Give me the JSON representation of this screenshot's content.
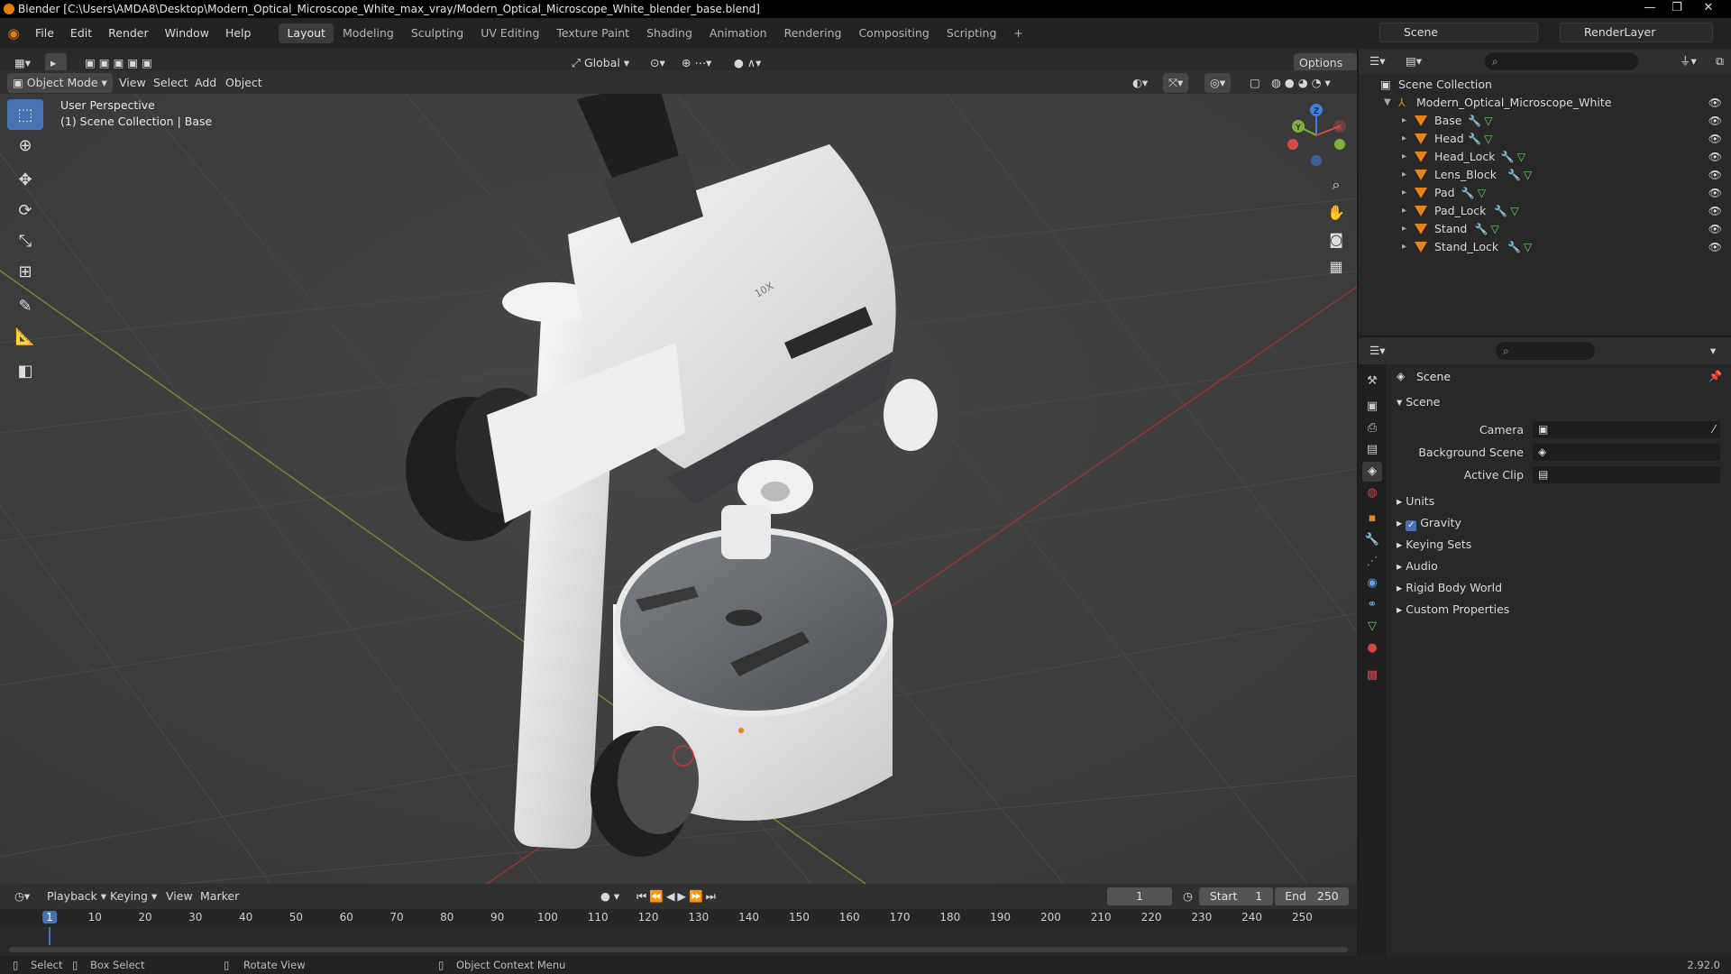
{
  "window": {
    "title": "Blender [C:\\Users\\AMDA8\\Desktop\\Modern_Optical_Microscope_White_max_vray/Modern_Optical_Microscope_White_blender_base.blend]"
  },
  "menu": {
    "items": [
      "File",
      "Edit",
      "Render",
      "Window",
      "Help"
    ],
    "workspaces": [
      "Layout",
      "Modeling",
      "Sculpting",
      "UV Editing",
      "Texture Paint",
      "Shading",
      "Animation",
      "Rendering",
      "Compositing",
      "Scripting"
    ],
    "active_workspace": "Layout",
    "add_tab": "+",
    "scene": "Scene",
    "render_layer": "RenderLayer"
  },
  "viewport": {
    "mode": "Object Mode",
    "menus": [
      "View",
      "Select",
      "Add",
      "Object"
    ],
    "transform_orientation": "Global",
    "options": "Options",
    "info_line1": "User Perspective",
    "info_line2": "(1) Scene Collection | Base",
    "mark_10x": "10X",
    "gizmo": {
      "x": "X",
      "y": "Y",
      "z": "Z"
    }
  },
  "outliner": {
    "root": "Scene Collection",
    "collection": "Modern_Optical_Microscope_White",
    "objects": [
      "Base",
      "Head",
      "Head_Lock",
      "Lens_Block",
      "Pad",
      "Pad_Lock",
      "Stand",
      "Stand_Lock"
    ]
  },
  "properties": {
    "header": "Scene",
    "panel": "Scene",
    "camera_label": "Camera",
    "background_scene_label": "Background Scene",
    "active_clip_label": "Active Clip",
    "sections": [
      "Units",
      "Gravity",
      "Keying Sets",
      "Audio",
      "Rigid Body World",
      "Custom Properties"
    ],
    "gravity_checked": true
  },
  "timeline": {
    "menus": [
      "Playback",
      "Keying",
      "View",
      "Marker"
    ],
    "current_frame": "1",
    "start_label": "Start",
    "start": "1",
    "end_label": "End",
    "end": "250",
    "ticks": [
      "1",
      "10",
      "20",
      "30",
      "40",
      "50",
      "60",
      "70",
      "80",
      "90",
      "100",
      "110",
      "120",
      "130",
      "140",
      "150",
      "160",
      "170",
      "180",
      "190",
      "200",
      "210",
      "220",
      "230",
      "240",
      "250"
    ]
  },
  "status": {
    "select": "Select",
    "box_select": "Box Select",
    "rotate_view": "Rotate View",
    "context_menu": "Object Context Menu",
    "version": "2.92.0"
  },
  "colors": {
    "accent": "#4772b3",
    "object_icon": "#e8841c",
    "modifier_icon": "#6aa0e0",
    "mesh_icon": "#6fd06f"
  }
}
